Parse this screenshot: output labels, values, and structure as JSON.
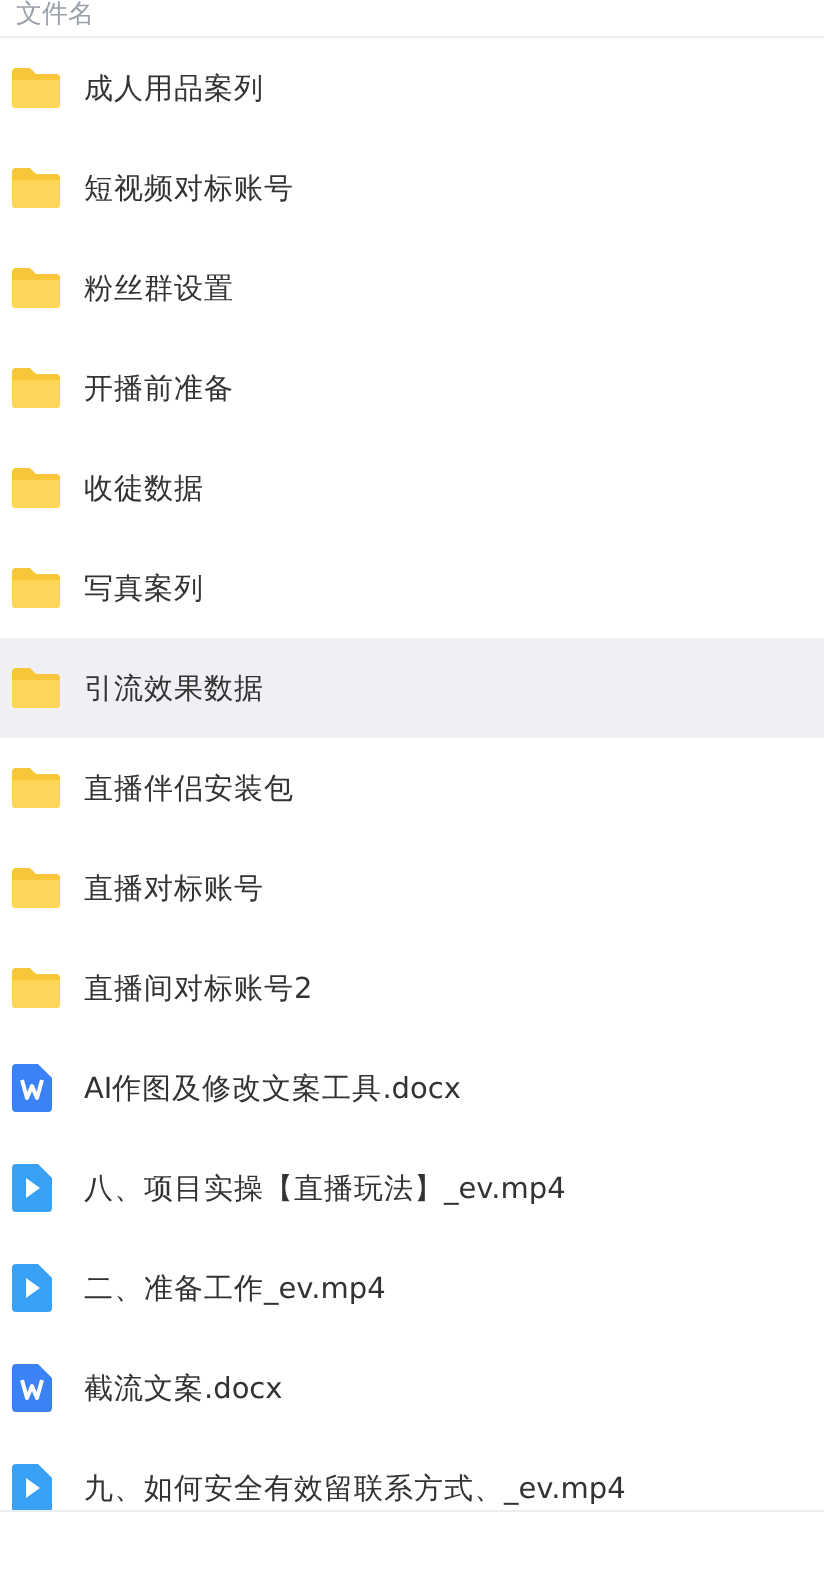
{
  "header": {
    "column_title": "文件名"
  },
  "files": [
    {
      "name": "成人用品案列",
      "kind": "folder",
      "selected": false
    },
    {
      "name": "短视频对标账号",
      "kind": "folder",
      "selected": false
    },
    {
      "name": "粉丝群设置",
      "kind": "folder",
      "selected": false
    },
    {
      "name": "开播前准备",
      "kind": "folder",
      "selected": false
    },
    {
      "name": "收徒数据",
      "kind": "folder",
      "selected": false
    },
    {
      "name": "写真案列",
      "kind": "folder",
      "selected": false
    },
    {
      "name": "引流效果数据",
      "kind": "folder",
      "selected": true
    },
    {
      "name": "直播伴侣安装包",
      "kind": "folder",
      "selected": false
    },
    {
      "name": "直播对标账号",
      "kind": "folder",
      "selected": false
    },
    {
      "name": "直播间对标账号2",
      "kind": "folder",
      "selected": false
    },
    {
      "name": "AI作图及修改文案工具.docx",
      "kind": "document",
      "selected": false
    },
    {
      "name": "八、项目实操【直播玩法】_ev.mp4",
      "kind": "video",
      "selected": false
    },
    {
      "name": "二、准备工作_ev.mp4",
      "kind": "video",
      "selected": false
    },
    {
      "name": "截流文案.docx",
      "kind": "document",
      "selected": false
    },
    {
      "name": "九、如何安全有效留联系方式、_ev.mp4",
      "kind": "video",
      "selected": false
    }
  ]
}
